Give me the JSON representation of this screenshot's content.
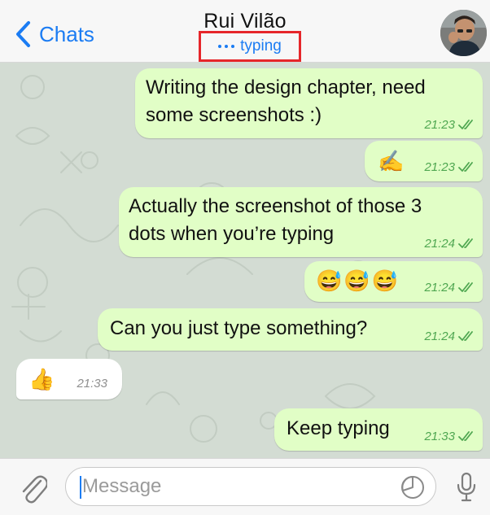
{
  "header": {
    "back_label": "Chats",
    "contact_name": "Rui Vilão",
    "status": "typing"
  },
  "messages": [
    {
      "direction": "out",
      "lines": [
        "Writing the design chapter, need",
        "some screenshots :)"
      ],
      "time": "21:23"
    },
    {
      "direction": "out",
      "emoji": "✍️",
      "time": "21:23"
    },
    {
      "direction": "out",
      "lines": [
        "Actually the screenshot of those 3",
        "dots when you’re typing"
      ],
      "time": "21:24"
    },
    {
      "direction": "out",
      "emoji": "😅😅😅",
      "time": "21:24"
    },
    {
      "direction": "out",
      "lines": [
        "Can you just type something?"
      ],
      "time": "21:24"
    },
    {
      "direction": "in",
      "emoji": "👍",
      "time": "21:33"
    },
    {
      "direction": "out",
      "lines": [
        "Keep typing"
      ],
      "time": "21:33"
    }
  ],
  "composer": {
    "placeholder": "Message"
  },
  "colors": {
    "accent": "#1b7cf3",
    "outgoing_bubble": "#e1fec6",
    "incoming_bubble": "#ffffff",
    "read_ticks": "#4fa751",
    "highlight_box": "#e6262a",
    "chat_background": "#d3dcd3"
  },
  "icons": {
    "back": "chevron-left-icon",
    "attach": "paperclip-icon",
    "sticker": "sticker-icon",
    "mic": "microphone-icon",
    "read": "double-check-icon"
  }
}
